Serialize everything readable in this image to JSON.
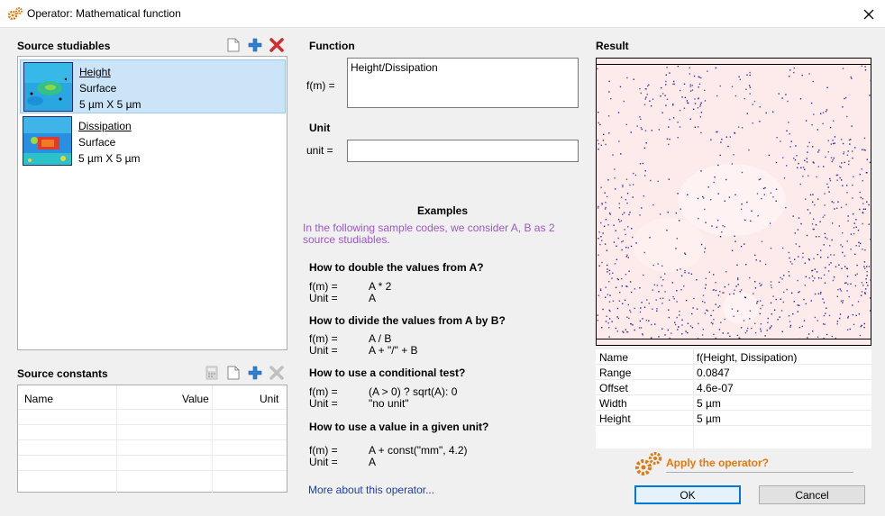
{
  "window": {
    "title": "Operator: Mathematical function"
  },
  "source_studiables": {
    "title": "Source studiables",
    "items": [
      {
        "name": "Height",
        "type": "Surface",
        "size": "5 µm X 5 µm",
        "selected": true
      },
      {
        "name": "Dissipation",
        "type": "Surface",
        "size": "5 µm X 5 µm",
        "selected": false
      }
    ]
  },
  "source_constants": {
    "title": "Source constants",
    "columns": [
      "Name",
      "Value",
      "Unit"
    ]
  },
  "function": {
    "title": "Function",
    "fm_label": "f(m) =",
    "fm_value": "Height/Dissipation",
    "unit_title": "Unit",
    "unit_label": "unit =",
    "unit_value": ""
  },
  "examples": {
    "title": "Examples",
    "intro": "In the following sample codes, we consider A, B as 2 source studiables.",
    "items": [
      {
        "question": "How to double the values from A?",
        "fm_label": "f(m) =",
        "fm": "A * 2",
        "unit_label": "Unit =",
        "unit": "A"
      },
      {
        "question": "How to divide the values from A by B?",
        "fm_label": "f(m) =",
        "fm": "A / B",
        "unit_label": "Unit =",
        "unit": "A + \"/\" + B"
      },
      {
        "question": "How to use a conditional test?",
        "fm_label": "f(m) =",
        "fm": "(A > 0) ? sqrt(A): 0",
        "unit_label": "Unit =",
        "unit": "\"no unit\""
      },
      {
        "question": "How to use a value in a given unit?",
        "fm_label": "f(m) =",
        "fm": "A + const(\"mm\", 4.2)",
        "unit_label": "Unit =",
        "unit": "A"
      }
    ],
    "more_link": "More about this operator..."
  },
  "result": {
    "title": "Result",
    "properties": [
      {
        "key": "Name",
        "value": "f(Height, Dissipation)"
      },
      {
        "key": "Range",
        "value": "0.0847"
      },
      {
        "key": "Offset",
        "value": "4.6e-07"
      },
      {
        "key": "Width",
        "value": "5 µm"
      },
      {
        "key": "Height",
        "value": "5 µm"
      }
    ]
  },
  "actions": {
    "apply_label": "Apply the operator?",
    "ok": "OK",
    "cancel": "Cancel"
  },
  "colors": {
    "accent_orange": "#e07a10",
    "link_blue": "#1a3ea5",
    "hint_purple": "#9b59c4",
    "selection": "#cce4f7"
  }
}
